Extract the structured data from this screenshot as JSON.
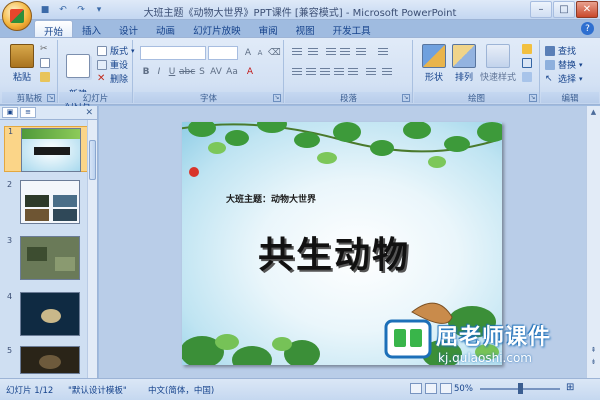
{
  "window": {
    "title": "大班主题《动物大世界》PPT课件 [兼容模式] - Microsoft PowerPoint"
  },
  "tabs": [
    "开始",
    "插入",
    "设计",
    "动画",
    "幻灯片放映",
    "审阅",
    "视图",
    "开发工具"
  ],
  "ribbon": {
    "clipboard": {
      "label": "剪贴板",
      "paste": "粘贴"
    },
    "slides": {
      "label": "幻灯片",
      "new_slide": "新建\n幻灯片",
      "layout": "版式",
      "reset": "重设",
      "delete": "删除"
    },
    "font": {
      "label": "字体"
    },
    "paragraph": {
      "label": "段落"
    },
    "drawing": {
      "label": "绘图",
      "shape": "形状",
      "arrange": "排列",
      "quick_style": "快速样式"
    },
    "editing": {
      "label": "编辑",
      "find": "查找",
      "replace": "替换",
      "select": "选择"
    }
  },
  "slides": {
    "numbers": [
      "1",
      "2",
      "3",
      "4",
      "5"
    ]
  },
  "current_slide": {
    "subtitle": "大班主题：动物大世界",
    "title": "共生动物"
  },
  "watermark": {
    "text": "屈老师课件",
    "url": "kj.qulaoshi.com"
  },
  "statusbar": {
    "slide_counter": "幻灯片 1/12",
    "template": "\"默认设计模板\"",
    "language": "中文(简体，中国)",
    "zoom": "50%"
  }
}
